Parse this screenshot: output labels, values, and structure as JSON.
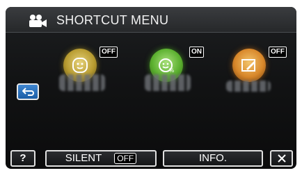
{
  "header": {
    "title": "SHORTCUT MENU",
    "mode_icon": "video-camera-icon"
  },
  "left": {
    "back_icon": "return-arrow-icon"
  },
  "items": [
    {
      "icon": "face-detection-icon",
      "status": "OFF",
      "color": "#c9ad3c"
    },
    {
      "icon": "smile-percent-icon",
      "status": "ON",
      "color": "#6cc03b"
    },
    {
      "icon": "pen-edit-icon",
      "status": "OFF",
      "color": "#e29a3a"
    }
  ],
  "bottom": {
    "help_label": "?",
    "silent_label": "SILENT",
    "silent_status": "OFF",
    "info_label": "INFO.",
    "close_icon": "close-icon"
  }
}
